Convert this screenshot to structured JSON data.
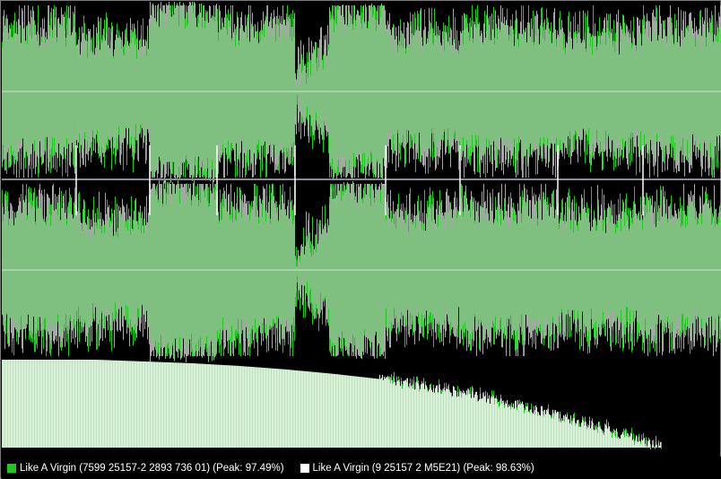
{
  "colors": {
    "track_a": "#1ec81e",
    "track_b": "#ffffff",
    "overlap": "#7fbf7f",
    "overlap_light": "#d8f0d8",
    "baseline": "#cfe8cf",
    "divider": "#8c8c96",
    "marker": "#ffffff"
  },
  "legend": {
    "a": {
      "label": "Like A Virgin (7599 25157-2 2893 736 01) (Peak: 97.49%)",
      "peak": 97.49
    },
    "b": {
      "label": "Like A Virgin (9 25157 2 M5E21) (Peak: 98.63%)",
      "peak": 98.63
    }
  },
  "chart_data": {
    "type": "area",
    "segment_levels": [
      0.68,
      0.55,
      0.9,
      0.7,
      0.16,
      0.5,
      0.86,
      0.6,
      0.68,
      0.6,
      0.66
    ],
    "distribution_profile": [
      1.0,
      1.0,
      1.0,
      0.98,
      0.96,
      0.93,
      0.89,
      0.84,
      0.78,
      0.7,
      0.6,
      0.48,
      0.34,
      0.18,
      0.0
    ]
  }
}
